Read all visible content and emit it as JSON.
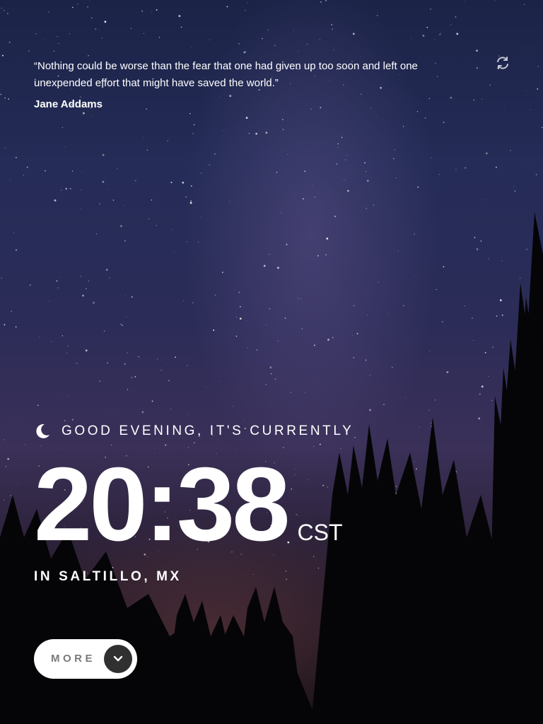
{
  "quote": {
    "text": "“Nothing could be worse than the fear that one had given up too soon and left one unexpended effort that might have saved the world.”",
    "author": "Jane Addams"
  },
  "refresh": {
    "icon": "refresh-icon"
  },
  "greeting": {
    "icon": "moon-icon",
    "text": "GOOD EVENING, IT'S CURRENTLY"
  },
  "clock": {
    "time": "20:38",
    "timezone": "CST"
  },
  "location": {
    "text": "IN SALTILLO, MX"
  },
  "more_button": {
    "label": "MORE",
    "icon": "chevron-down-icon"
  },
  "colors": {
    "text": "#ffffff",
    "button_bg": "#ffffff",
    "button_label": "#7a7a7a",
    "chevron_bg": "#303030"
  }
}
